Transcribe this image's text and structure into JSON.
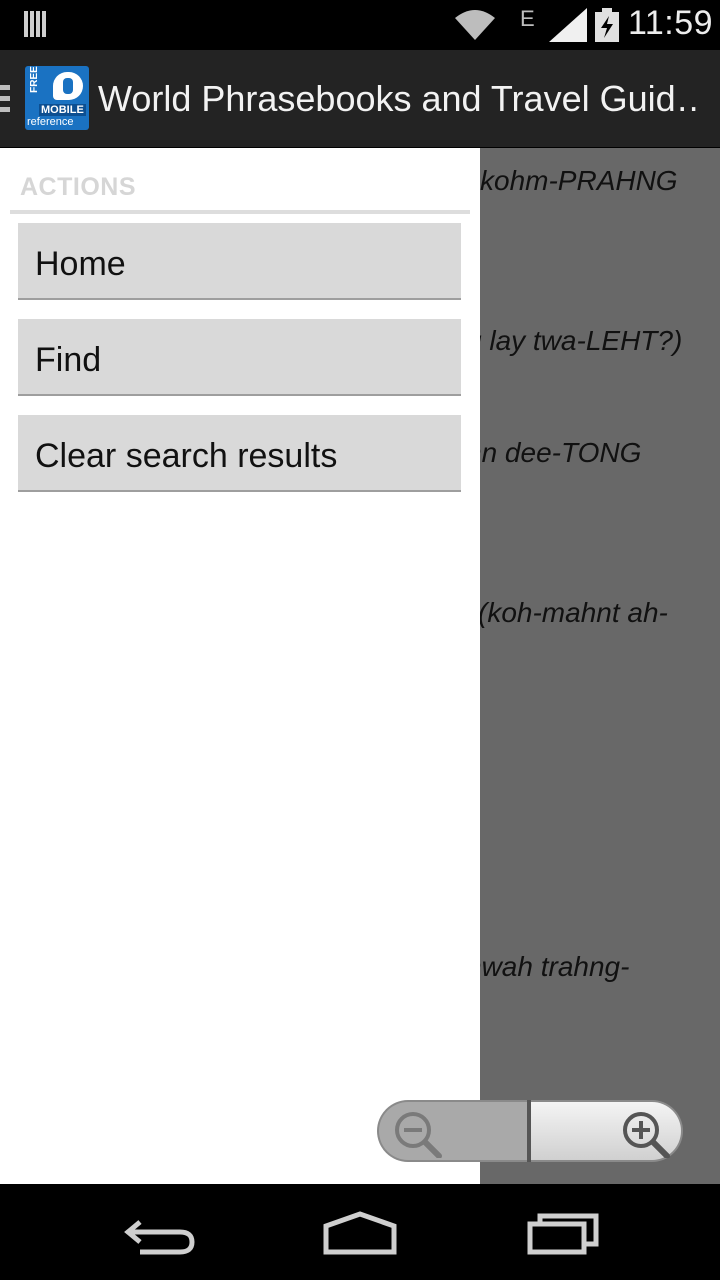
{
  "status_bar": {
    "time": "11:59",
    "network_type": "E",
    "icons": [
      "notification-icon",
      "wifi-icon",
      "signal-icon",
      "battery-charging-icon"
    ]
  },
  "action_bar": {
    "title": "World Phrasebooks and Travel Guid…",
    "app_icon": {
      "badge": "FREE",
      "brand_line1": "MOBILE",
      "brand_line2": "reference"
    }
  },
  "drawer": {
    "section_header": "ACTIONS",
    "items": [
      {
        "label": "Home"
      },
      {
        "label": "Find"
      },
      {
        "label": "Clear search results"
      }
    ]
  },
  "background_text": [
    "kohm-PRAHNG",
    "g lay twa-LEHT?)",
    "hn dee-TONG",
    "(koh-mahnt ah-",
    "nwah trahng-"
  ],
  "zoom": {
    "out_icon": "zoom-out-icon",
    "in_icon": "zoom-in-icon"
  },
  "nav_bar": {
    "icons": [
      "back-icon",
      "home-icon",
      "recent-apps-icon"
    ]
  },
  "colors": {
    "action_bar": "#232323",
    "drawer_background": "#ffffff",
    "drawer_item": "#d9d9d9",
    "scrim": "#686868",
    "app_icon_blue": "#1a72c2"
  }
}
